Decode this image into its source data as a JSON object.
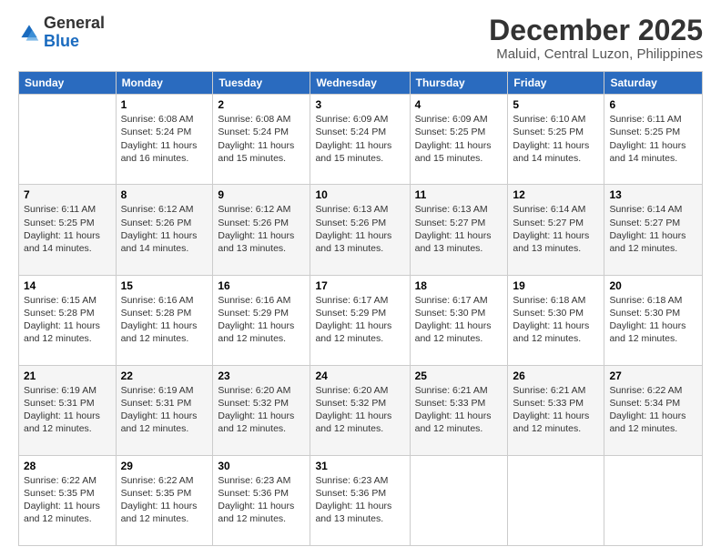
{
  "logo": {
    "general": "General",
    "blue": "Blue"
  },
  "header": {
    "month_year": "December 2025",
    "location": "Maluid, Central Luzon, Philippines"
  },
  "days_of_week": [
    "Sunday",
    "Monday",
    "Tuesday",
    "Wednesday",
    "Thursday",
    "Friday",
    "Saturday"
  ],
  "weeks": [
    [
      {
        "day": "",
        "info": ""
      },
      {
        "day": "1",
        "info": "Sunrise: 6:08 AM\nSunset: 5:24 PM\nDaylight: 11 hours\nand 16 minutes."
      },
      {
        "day": "2",
        "info": "Sunrise: 6:08 AM\nSunset: 5:24 PM\nDaylight: 11 hours\nand 15 minutes."
      },
      {
        "day": "3",
        "info": "Sunrise: 6:09 AM\nSunset: 5:24 PM\nDaylight: 11 hours\nand 15 minutes."
      },
      {
        "day": "4",
        "info": "Sunrise: 6:09 AM\nSunset: 5:25 PM\nDaylight: 11 hours\nand 15 minutes."
      },
      {
        "day": "5",
        "info": "Sunrise: 6:10 AM\nSunset: 5:25 PM\nDaylight: 11 hours\nand 14 minutes."
      },
      {
        "day": "6",
        "info": "Sunrise: 6:11 AM\nSunset: 5:25 PM\nDaylight: 11 hours\nand 14 minutes."
      }
    ],
    [
      {
        "day": "7",
        "info": "Sunrise: 6:11 AM\nSunset: 5:25 PM\nDaylight: 11 hours\nand 14 minutes."
      },
      {
        "day": "8",
        "info": "Sunrise: 6:12 AM\nSunset: 5:26 PM\nDaylight: 11 hours\nand 14 minutes."
      },
      {
        "day": "9",
        "info": "Sunrise: 6:12 AM\nSunset: 5:26 PM\nDaylight: 11 hours\nand 13 minutes."
      },
      {
        "day": "10",
        "info": "Sunrise: 6:13 AM\nSunset: 5:26 PM\nDaylight: 11 hours\nand 13 minutes."
      },
      {
        "day": "11",
        "info": "Sunrise: 6:13 AM\nSunset: 5:27 PM\nDaylight: 11 hours\nand 13 minutes."
      },
      {
        "day": "12",
        "info": "Sunrise: 6:14 AM\nSunset: 5:27 PM\nDaylight: 11 hours\nand 13 minutes."
      },
      {
        "day": "13",
        "info": "Sunrise: 6:14 AM\nSunset: 5:27 PM\nDaylight: 11 hours\nand 12 minutes."
      }
    ],
    [
      {
        "day": "14",
        "info": "Sunrise: 6:15 AM\nSunset: 5:28 PM\nDaylight: 11 hours\nand 12 minutes."
      },
      {
        "day": "15",
        "info": "Sunrise: 6:16 AM\nSunset: 5:28 PM\nDaylight: 11 hours\nand 12 minutes."
      },
      {
        "day": "16",
        "info": "Sunrise: 6:16 AM\nSunset: 5:29 PM\nDaylight: 11 hours\nand 12 minutes."
      },
      {
        "day": "17",
        "info": "Sunrise: 6:17 AM\nSunset: 5:29 PM\nDaylight: 11 hours\nand 12 minutes."
      },
      {
        "day": "18",
        "info": "Sunrise: 6:17 AM\nSunset: 5:30 PM\nDaylight: 11 hours\nand 12 minutes."
      },
      {
        "day": "19",
        "info": "Sunrise: 6:18 AM\nSunset: 5:30 PM\nDaylight: 11 hours\nand 12 minutes."
      },
      {
        "day": "20",
        "info": "Sunrise: 6:18 AM\nSunset: 5:30 PM\nDaylight: 11 hours\nand 12 minutes."
      }
    ],
    [
      {
        "day": "21",
        "info": "Sunrise: 6:19 AM\nSunset: 5:31 PM\nDaylight: 11 hours\nand 12 minutes."
      },
      {
        "day": "22",
        "info": "Sunrise: 6:19 AM\nSunset: 5:31 PM\nDaylight: 11 hours\nand 12 minutes."
      },
      {
        "day": "23",
        "info": "Sunrise: 6:20 AM\nSunset: 5:32 PM\nDaylight: 11 hours\nand 12 minutes."
      },
      {
        "day": "24",
        "info": "Sunrise: 6:20 AM\nSunset: 5:32 PM\nDaylight: 11 hours\nand 12 minutes."
      },
      {
        "day": "25",
        "info": "Sunrise: 6:21 AM\nSunset: 5:33 PM\nDaylight: 11 hours\nand 12 minutes."
      },
      {
        "day": "26",
        "info": "Sunrise: 6:21 AM\nSunset: 5:33 PM\nDaylight: 11 hours\nand 12 minutes."
      },
      {
        "day": "27",
        "info": "Sunrise: 6:22 AM\nSunset: 5:34 PM\nDaylight: 11 hours\nand 12 minutes."
      }
    ],
    [
      {
        "day": "28",
        "info": "Sunrise: 6:22 AM\nSunset: 5:35 PM\nDaylight: 11 hours\nand 12 minutes."
      },
      {
        "day": "29",
        "info": "Sunrise: 6:22 AM\nSunset: 5:35 PM\nDaylight: 11 hours\nand 12 minutes."
      },
      {
        "day": "30",
        "info": "Sunrise: 6:23 AM\nSunset: 5:36 PM\nDaylight: 11 hours\nand 12 minutes."
      },
      {
        "day": "31",
        "info": "Sunrise: 6:23 AM\nSunset: 5:36 PM\nDaylight: 11 hours\nand 13 minutes."
      },
      {
        "day": "",
        "info": ""
      },
      {
        "day": "",
        "info": ""
      },
      {
        "day": "",
        "info": ""
      }
    ]
  ]
}
